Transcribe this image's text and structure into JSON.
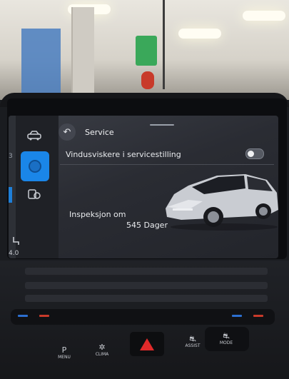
{
  "screen": {
    "title": "Service",
    "back_icon": "↶",
    "wiper_label": "Vindusviskere i servicestilling",
    "wiper_toggle_on": false,
    "inspection_label": "Inspeksjon om",
    "inspection_value": "545 Dager"
  },
  "sidebar": {
    "edge_number": "3",
    "bottom_text": "4.0",
    "icons": [
      "car-icon",
      "settings-icon",
      "service-icon"
    ]
  },
  "console": {
    "buttons": [
      {
        "label": "MENU",
        "icon": "P"
      },
      {
        "label": "CLIMA",
        "icon": "✲"
      },
      {
        "label": "ASSIST",
        "icon": "⛐"
      },
      {
        "label": "MODE",
        "icon": "⛐"
      }
    ]
  },
  "colors": {
    "accent": "#1a86e8",
    "hazard": "#e02a2a",
    "car_body": "#c9ccd2"
  }
}
